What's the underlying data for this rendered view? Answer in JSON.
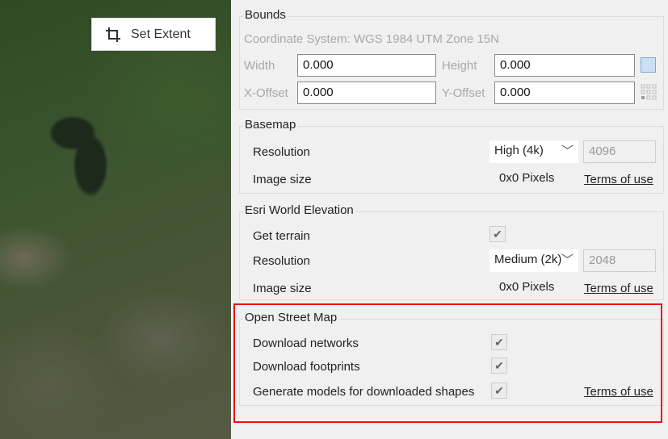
{
  "map": {
    "set_extent_label": "Set Extent"
  },
  "bounds": {
    "title": "Bounds",
    "coordinate_system": "Coordinate System: WGS 1984 UTM Zone 15N",
    "width_label": "Width",
    "width_value": "0.000",
    "height_label": "Height",
    "height_value": "0.000",
    "xoffset_label": "X-Offset",
    "xoffset_value": "0.000",
    "yoffset_label": "Y-Offset",
    "yoffset_value": "0.000"
  },
  "basemap": {
    "title": "Basemap",
    "resolution_label": "Resolution",
    "resolution_value": "High (4k)",
    "resolution_pixels": "4096",
    "image_size_label": "Image size",
    "image_size_value": "0x0 Pixels",
    "terms": "Terms of use"
  },
  "elevation": {
    "title": "Esri World Elevation",
    "get_terrain_label": "Get terrain",
    "get_terrain_checked": true,
    "resolution_label": "Resolution",
    "resolution_value": "Medium (2k)",
    "resolution_pixels": "2048",
    "image_size_label": "Image size",
    "image_size_value": "0x0 Pixels",
    "terms": "Terms of use"
  },
  "osm": {
    "title": "Open Street Map",
    "download_networks_label": "Download networks",
    "download_networks_checked": true,
    "download_footprints_label": "Download footprints",
    "download_footprints_checked": true,
    "generate_models_label": "Generate models for downloaded shapes",
    "generate_models_checked": true,
    "terms": "Terms of use"
  },
  "colors": {
    "highlight": "#ee1111"
  }
}
